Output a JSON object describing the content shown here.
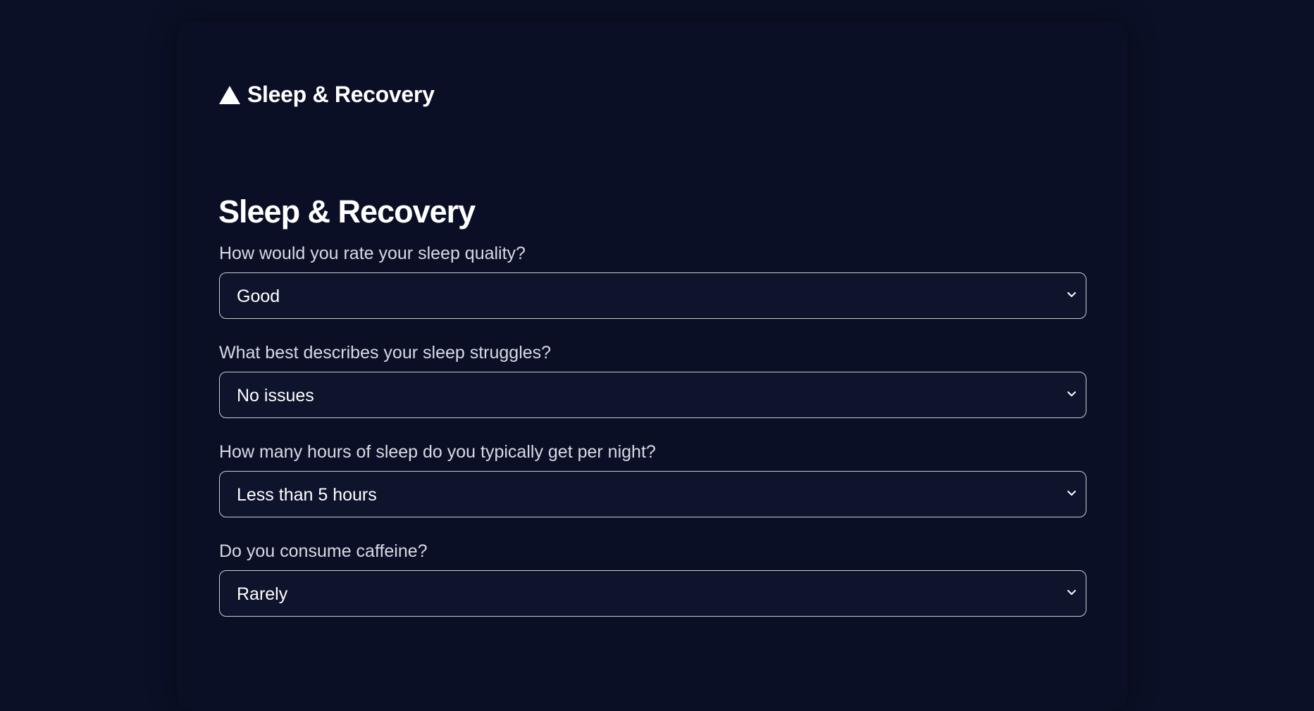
{
  "brand": {
    "logo_icon": "triangle-icon",
    "name": "Sleep & Recovery"
  },
  "page": {
    "title": "Sleep & Recovery"
  },
  "questions": [
    {
      "label": "How would you rate your sleep quality?",
      "selected": "Good"
    },
    {
      "label": "What best describes your sleep struggles?",
      "selected": "No issues"
    },
    {
      "label": "How many hours of sleep do you typically get per night?",
      "selected": "Less than 5 hours"
    },
    {
      "label": "Do you consume caffeine?",
      "selected": "Rarely"
    }
  ],
  "colors": {
    "background": "#0b1027",
    "card": "#0a0f26",
    "field_bg": "#0f142d",
    "border": "#c9ccd6",
    "text": "#ffffff",
    "label": "#d7dae4"
  }
}
